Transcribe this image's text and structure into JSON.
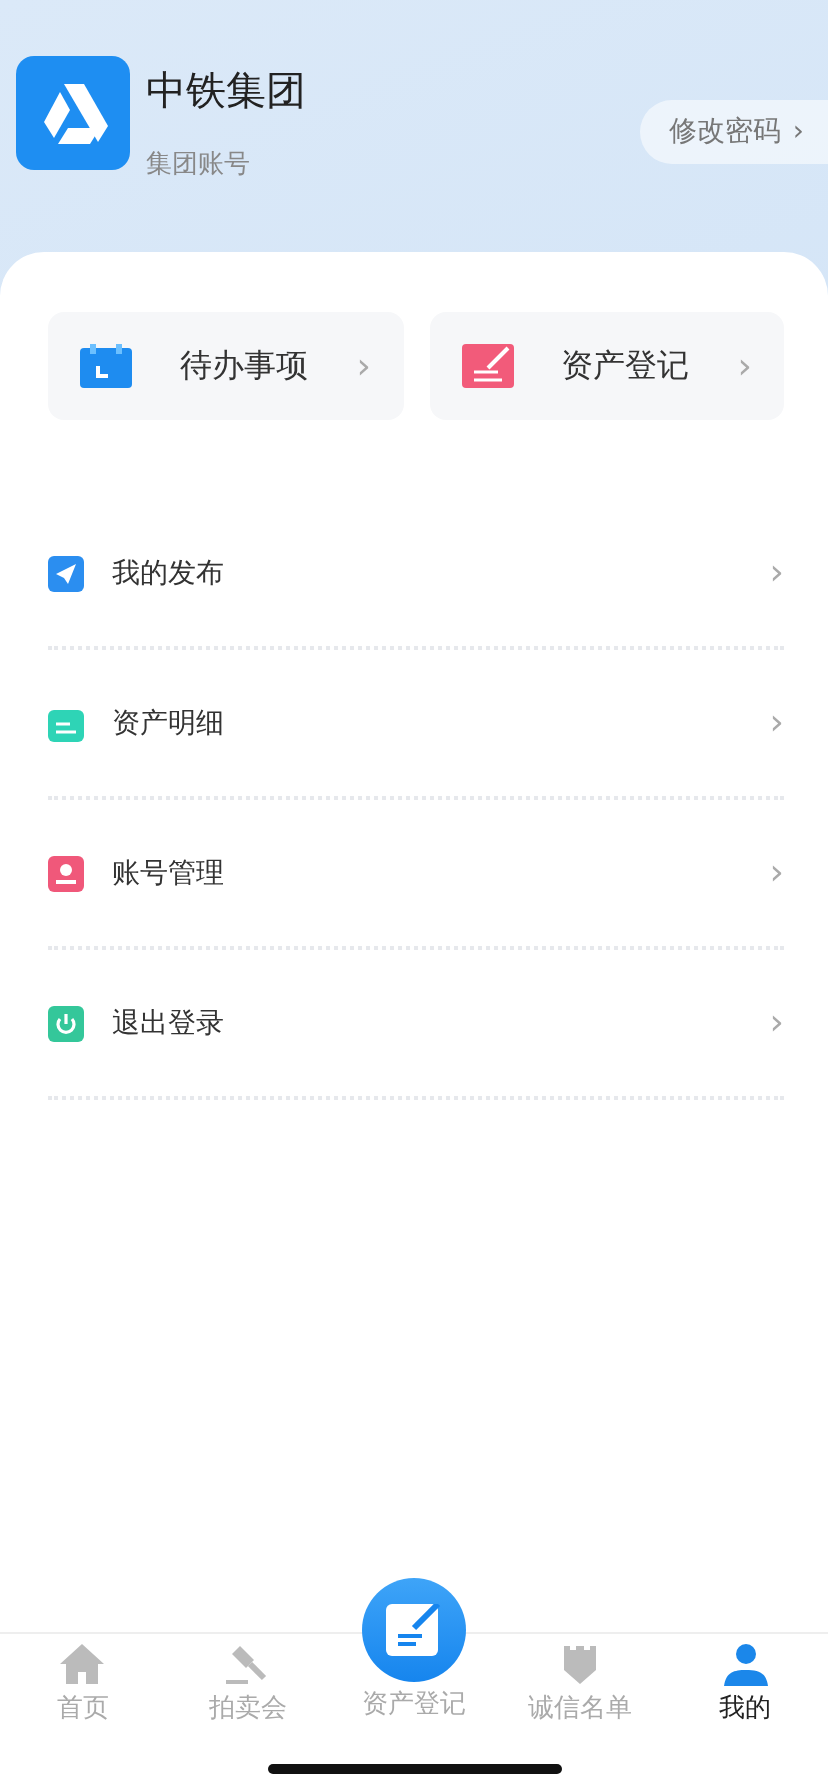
{
  "profile": {
    "name": "中铁集团",
    "subtitle": "集团账号",
    "action": "修改密码",
    "action_chevron": "›"
  },
  "quick_actions": [
    {
      "kind": "calendar",
      "label": "待办事项",
      "chevron": "›"
    },
    {
      "kind": "register",
      "label": "资产登记",
      "chevron": "›"
    }
  ],
  "menu": [
    {
      "kind": "send",
      "label": "我的发布",
      "chevron": "›"
    },
    {
      "kind": "notes",
      "label": "资产明细",
      "chevron": "›"
    },
    {
      "kind": "user",
      "label": "账号管理",
      "chevron": "›"
    },
    {
      "kind": "power",
      "label": "退出登录",
      "chevron": "›"
    }
  ],
  "tab_bar": [
    {
      "kind": "home",
      "label": "首页",
      "selected": false
    },
    {
      "kind": "gavel",
      "label": "拍卖会",
      "selected": false
    },
    {
      "kind": "center",
      "label": "资产登记",
      "selected": false
    },
    {
      "kind": "shield",
      "label": "诚信名单",
      "selected": false
    },
    {
      "kind": "person",
      "label": "我的",
      "selected": true
    }
  ]
}
